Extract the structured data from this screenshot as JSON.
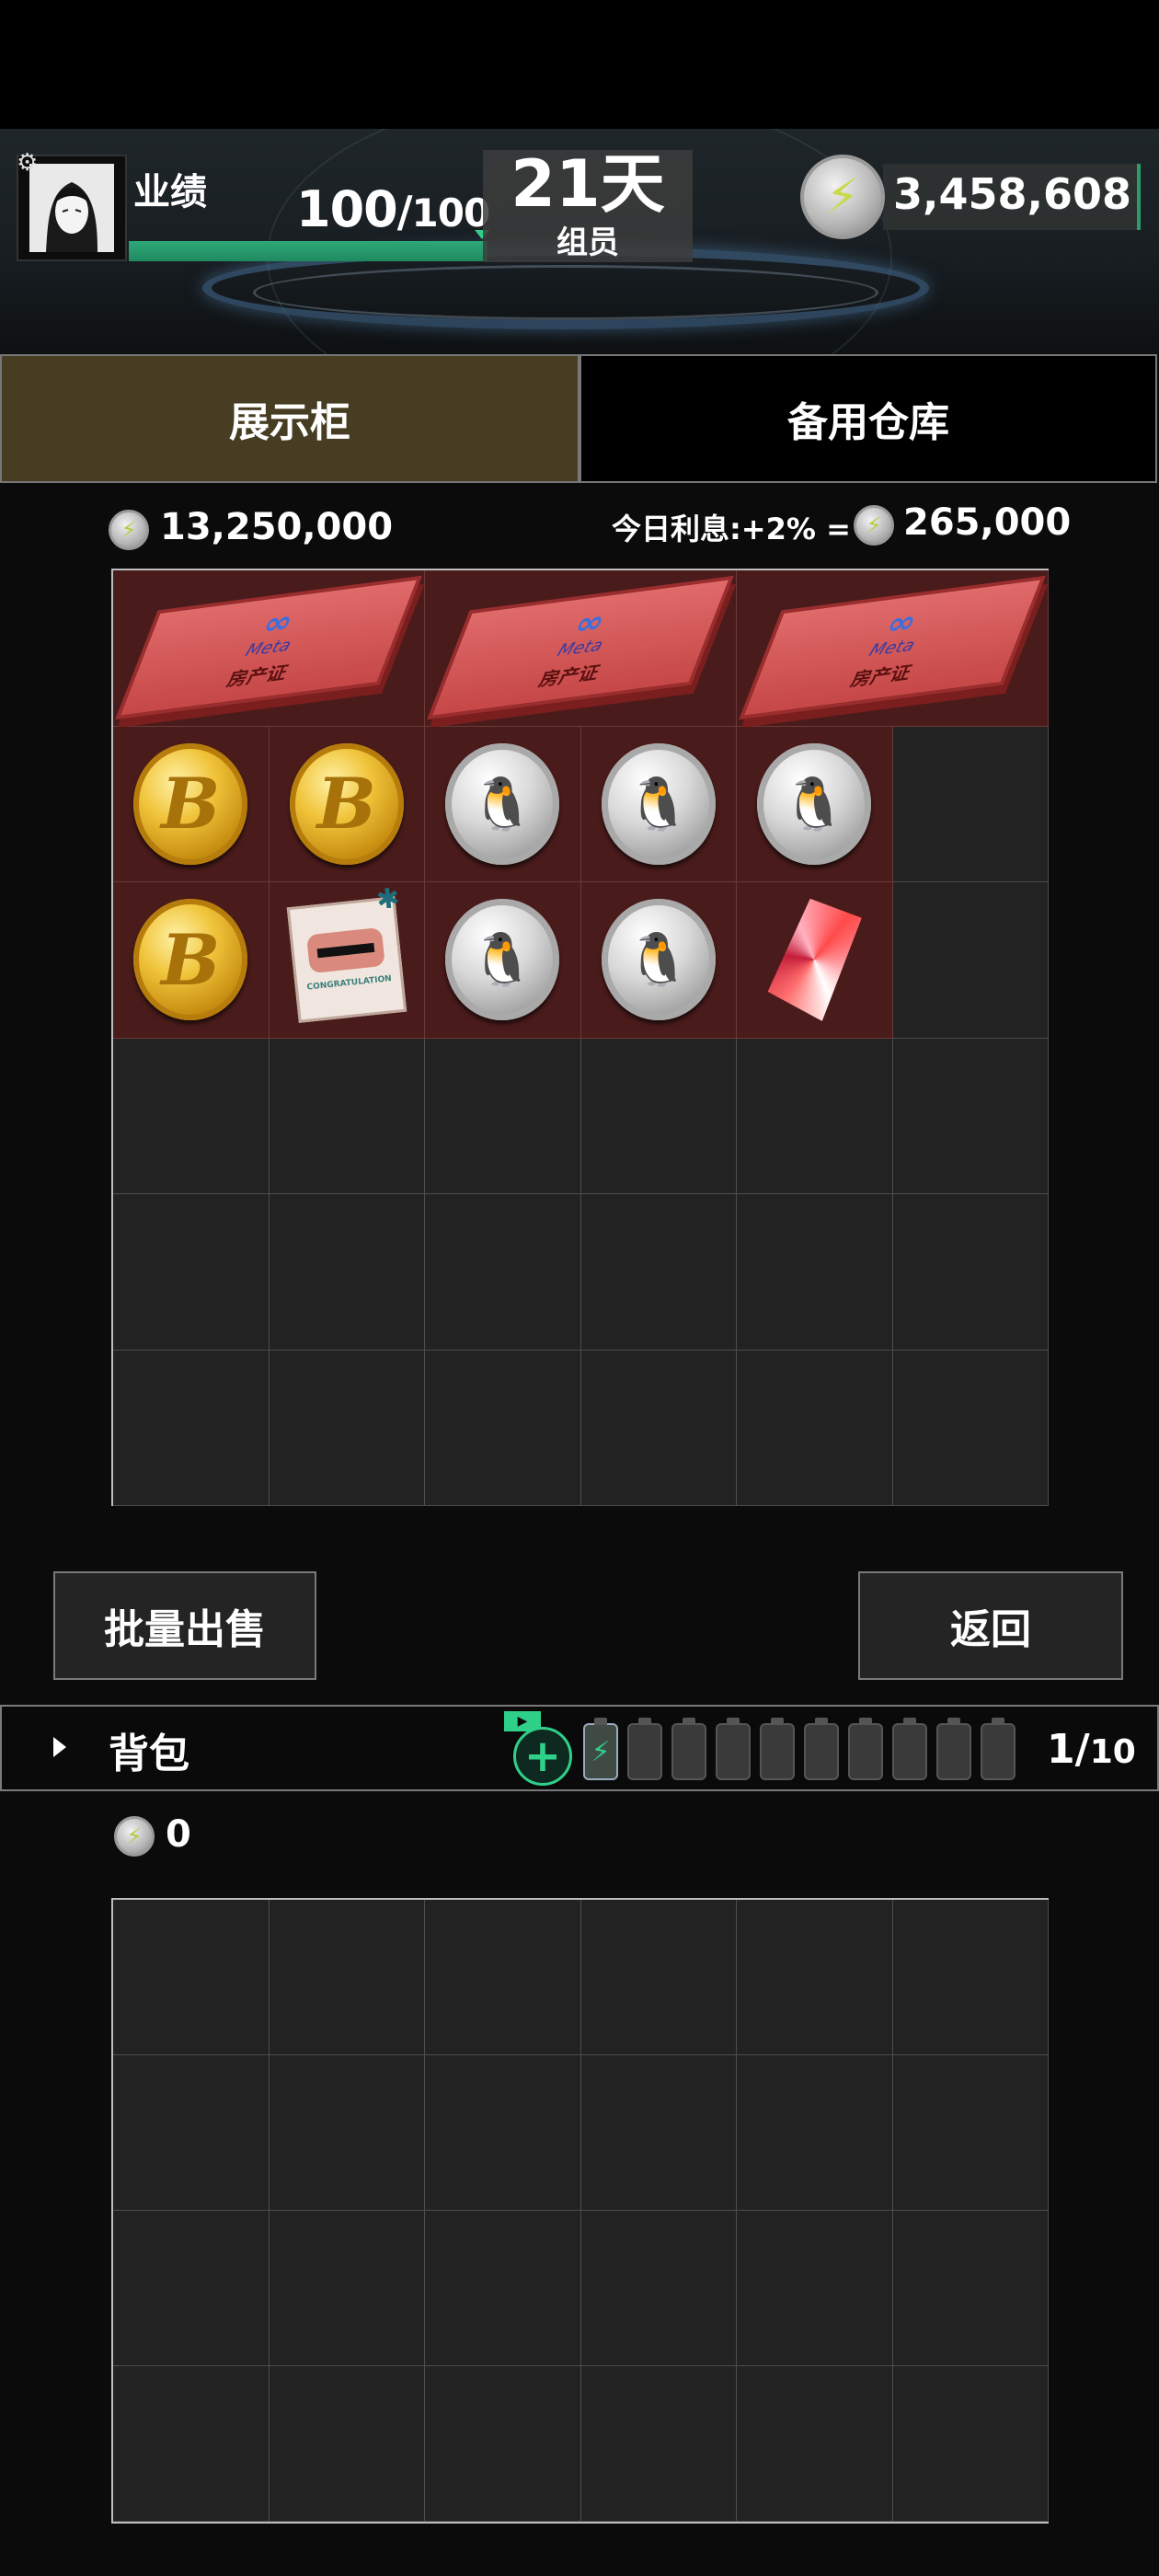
{
  "header": {
    "performance_label": "业绩",
    "performance_current": "100",
    "performance_separator": "/",
    "performance_max": "100",
    "performance_fraction": 1.0,
    "day_value": "21天",
    "day_subtitle": "组员",
    "currency_value": "3,458,608",
    "accent_color": "#2fd08a"
  },
  "tabs": [
    {
      "label": "展示柜",
      "active": true
    },
    {
      "label": "备用仓库",
      "active": false
    }
  ],
  "showcase": {
    "balance": "13,250,000",
    "interest_label": "今日利息:+2% =",
    "interest_value": "265,000",
    "deed": {
      "logo": "∞",
      "brand": "Meta",
      "title": "房产证"
    }
  },
  "buttons": {
    "bulk_sell": "批量出售",
    "back": "返回"
  },
  "backpack": {
    "label": "背包",
    "video_icon": "▶",
    "count_current": "1",
    "count_separator": "/",
    "count_max": "10",
    "balance": "0"
  },
  "icons": {
    "coin_bolt": "⚡",
    "gold_coin_symbol": "B",
    "silver_coin_symbol": "🐧"
  }
}
